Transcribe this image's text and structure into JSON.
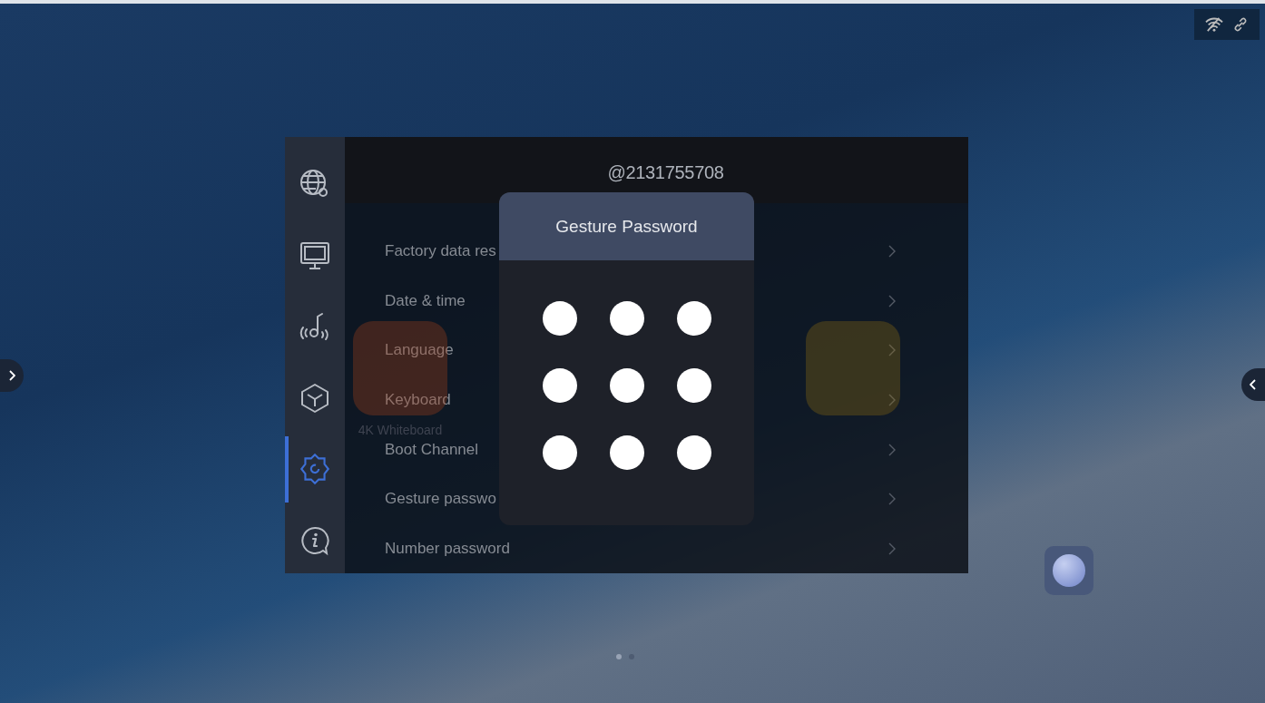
{
  "desktop": {
    "apps": [
      {
        "kind": "whiteboard",
        "label": "4K Whiteboard"
      },
      {
        "kind": "screen-share"
      }
    ],
    "page_dots": [
      {
        "selected": true
      },
      {
        "selected": false
      }
    ]
  },
  "settings": {
    "sidebar": [
      {
        "kind": "network",
        "selected": false
      },
      {
        "kind": "display",
        "selected": false
      },
      {
        "kind": "audio",
        "selected": false
      },
      {
        "kind": "apps",
        "selected": false
      },
      {
        "kind": "system",
        "selected": true
      },
      {
        "kind": "about",
        "selected": false
      }
    ],
    "header": "@2131755708",
    "rows": [
      {
        "label": "Factory data res"
      },
      {
        "label": "Date & time"
      },
      {
        "label": "Language"
      },
      {
        "label": "Keyboard"
      },
      {
        "label": "Boot Channel"
      },
      {
        "label": "Gesture passwo"
      },
      {
        "label": "Number password"
      }
    ]
  },
  "dialog": {
    "title": "Gesture Password",
    "pattern_points": [
      {
        "selected": false
      },
      {
        "selected": false
      },
      {
        "selected": false
      },
      {
        "selected": false
      },
      {
        "selected": false
      },
      {
        "selected": false
      },
      {
        "selected": false
      },
      {
        "selected": false
      },
      {
        "selected": false
      }
    ]
  }
}
